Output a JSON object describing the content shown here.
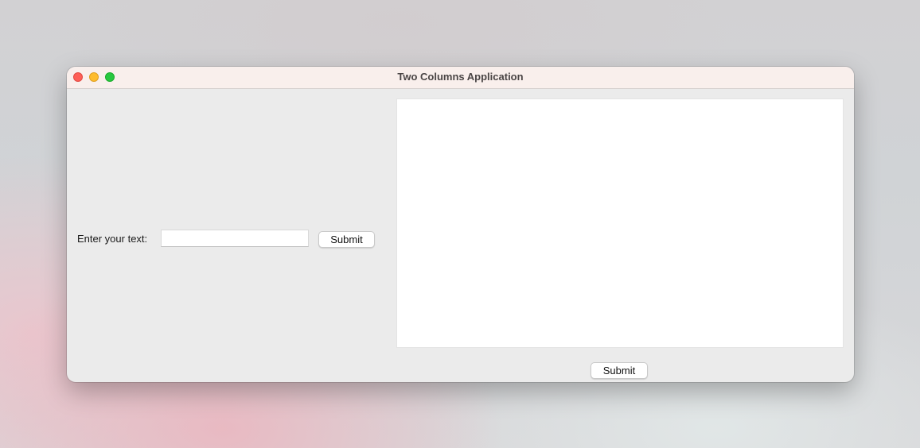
{
  "window": {
    "title": "Two Columns Application"
  },
  "left_column": {
    "label": "Enter your text:",
    "input_value": "",
    "submit_label": "Submit"
  },
  "right_column": {
    "text_area_value": "",
    "submit_label": "Submit"
  },
  "colors": {
    "close_button": "#fe5f57",
    "minimize_button": "#febc2e",
    "maximize_button": "#28c840",
    "window_background": "#ebebeb",
    "titlebar_background": "#f9efec"
  }
}
